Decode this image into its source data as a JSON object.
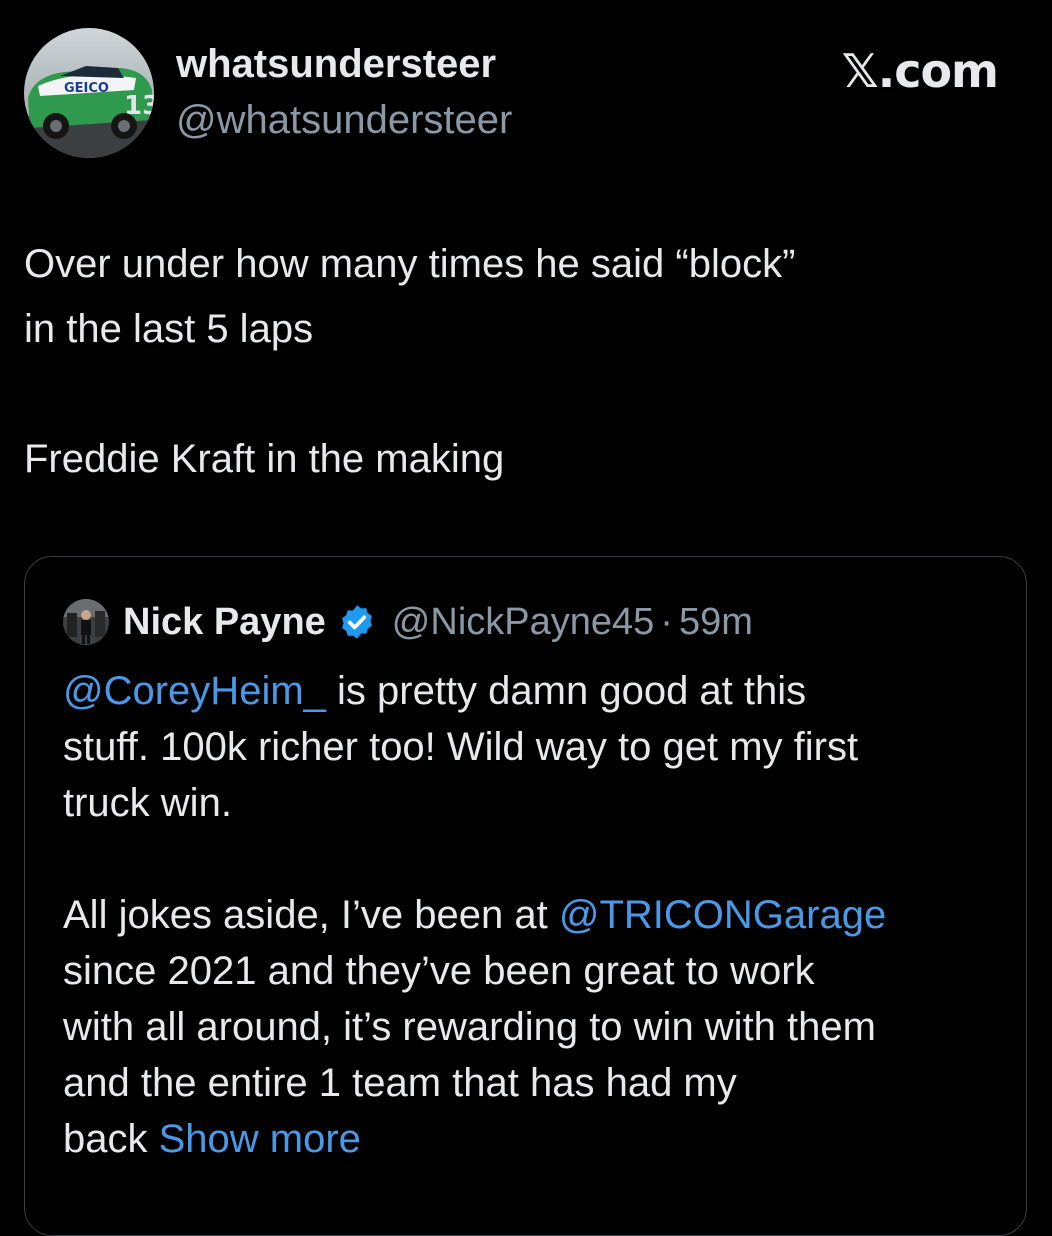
{
  "author": {
    "display_name": "whatsundersteer",
    "handle": "@whatsundersteer",
    "avatar_icon": "race-car-avatar"
  },
  "site_brand": "𝕏.com",
  "tweet": {
    "line1": "Over under how many times he said “block”",
    "line2": "in the last 5 laps",
    "line3": "Freddie Kraft in the making"
  },
  "quote": {
    "display_name": "Nick Payne",
    "handle": "@NickPayne45",
    "separator": "·",
    "time": "59m",
    "verified_icon": "verified-badge-icon",
    "para1": {
      "mention": "@CoreyHeim_",
      "text_line1_rest": " is pretty damn good at this",
      "text_line2": "stuff. 100k richer too! Wild way to get my first",
      "text_line3": "truck win."
    },
    "para2": {
      "line1_prefix": "All jokes aside, I’ve been at ",
      "line1_mention": "@TRICONGarage",
      "line2": "since 2021 and they’ve been great to work",
      "line3": "with all around, it’s rewarding to win with them",
      "line4": "and the entire 1 team that has had my",
      "line5_prefix": "back ",
      "show_more": "Show more"
    }
  },
  "colors": {
    "background": "#000000",
    "text_primary": "#e7e9ea",
    "text_secondary": "#8b98a5",
    "link": "#4a99e9",
    "verified": "#1d9bf0",
    "card_border": "#3a3d41"
  }
}
